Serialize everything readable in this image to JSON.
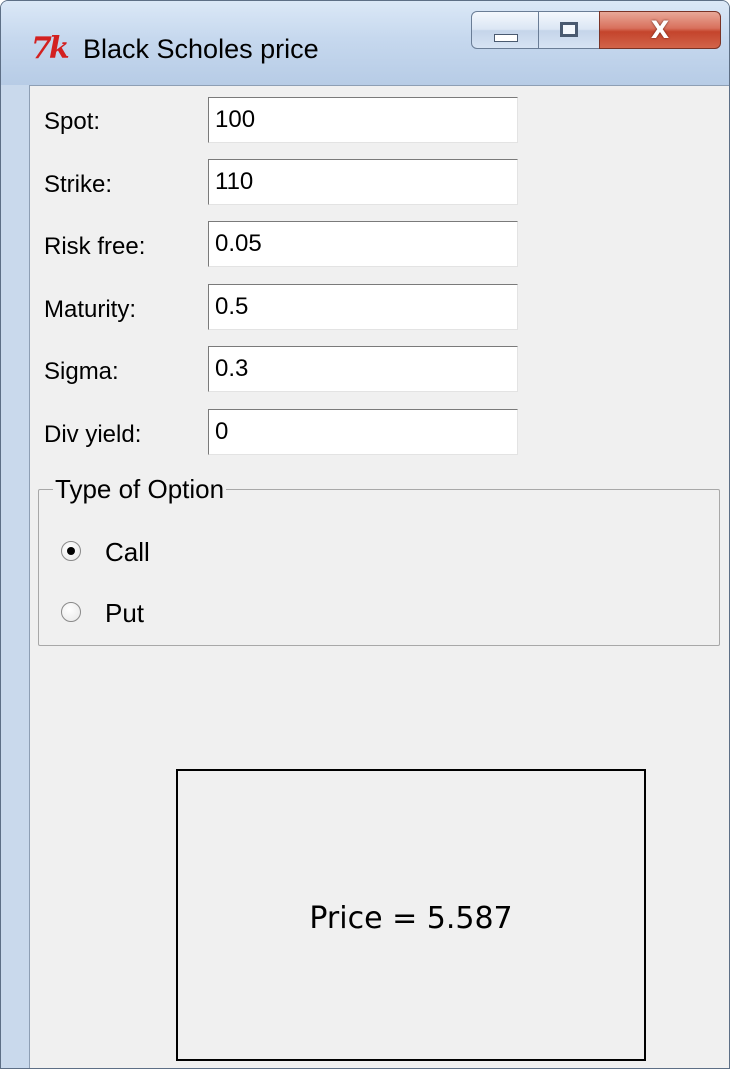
{
  "window": {
    "title": "Black Scholes price",
    "icon": "tk-feather-icon",
    "close_glyph": "X"
  },
  "fields": [
    {
      "label": "Spot:",
      "value": "100"
    },
    {
      "label": "Strike:",
      "value": "110"
    },
    {
      "label": "Risk free:",
      "value": "0.05"
    },
    {
      "label": "Maturity:",
      "value": "0.5"
    },
    {
      "label": "Sigma:",
      "value": "0.3"
    },
    {
      "label": "Div yield:",
      "value": "0"
    }
  ],
  "option_type": {
    "legend": "Type of Option",
    "options": [
      {
        "label": "Call",
        "selected": true
      },
      {
        "label": "Put",
        "selected": false
      }
    ]
  },
  "result": {
    "text": "Price = 5.587"
  },
  "colors": {
    "close_button": "#c4442c",
    "client_background": "#f0f0f0",
    "title_bar": "#c6d8ee"
  }
}
